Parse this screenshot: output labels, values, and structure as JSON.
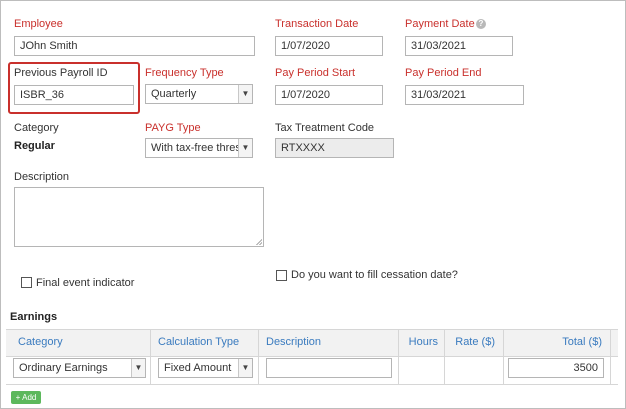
{
  "form": {
    "employee_label": "Employee",
    "employee_value": "JOhn Smith",
    "transaction_date_label": "Transaction Date",
    "transaction_date_value": "1/07/2020",
    "payment_date_label": "Payment Date",
    "payment_date_value": "31/03/2021",
    "help_glyph": "?",
    "previous_payroll_id_label": "Previous Payroll ID",
    "previous_payroll_id_value": "ISBR_36",
    "frequency_type_label": "Frequency Type",
    "frequency_type_value": "Quarterly",
    "pay_period_start_label": "Pay Period Start",
    "pay_period_start_value": "1/07/2020",
    "pay_period_end_label": "Pay Period End",
    "pay_period_end_value": "31/03/2021",
    "category_label": "Category",
    "category_value": "Regular",
    "payg_type_label": "PAYG Type",
    "payg_type_value": "With tax-free thresh",
    "tax_treatment_code_label": "Tax Treatment Code",
    "tax_treatment_code_value": "RTXXXX",
    "description_label": "Description",
    "final_event_label": "Final event indicator",
    "cessation_label": "Do you want to fill cessation date?"
  },
  "earnings": {
    "title": "Earnings",
    "columns": [
      "Category",
      "Calculation Type",
      "Description",
      "Hours",
      "Rate ($)",
      "Total ($)"
    ],
    "row": {
      "category": "Ordinary Earnings",
      "calculation_type": "Fixed Amount",
      "description": "",
      "total": "3500"
    },
    "add_label": "+ Add"
  },
  "colors": {
    "required_label": "#c9302c",
    "column_header": "#3a7bbf",
    "add_button": "#5cb85c",
    "highlight_box": "#c9302c"
  }
}
